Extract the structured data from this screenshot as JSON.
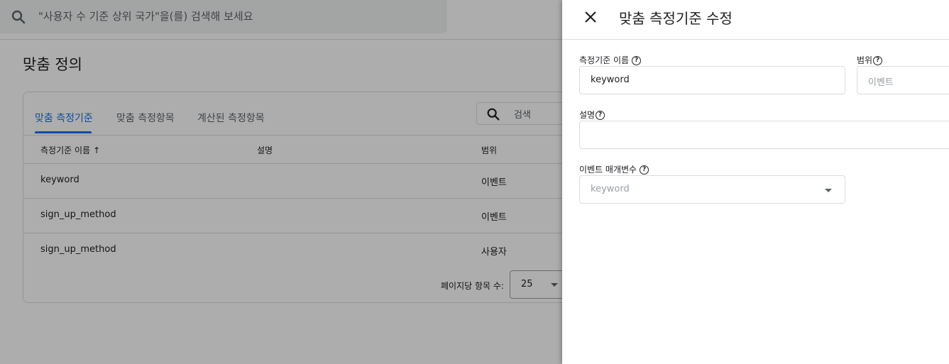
{
  "top_search": {
    "placeholder": "\"사용자 수 기준 상위 국가\"을(를) 검색해 보세요",
    "icon": "search-icon"
  },
  "page": {
    "title": "맞춤 정의"
  },
  "tabs": [
    {
      "label": "맞춤 측정기준",
      "active": true
    },
    {
      "label": "맞춤 측정항목",
      "active": false
    },
    {
      "label": "계산된 측정항목",
      "active": false
    }
  ],
  "table_search": {
    "placeholder": "검색"
  },
  "table": {
    "columns": [
      "측정기준 이름",
      "설명",
      "범위"
    ],
    "sort_arrow": "↑",
    "rows": [
      {
        "name": "keyword",
        "desc": "",
        "scope": "이벤트"
      },
      {
        "name": "sign_up_method",
        "desc": "",
        "scope": "이벤트"
      },
      {
        "name": "sign_up_method",
        "desc": "",
        "scope": "사용자"
      }
    ]
  },
  "pager": {
    "label": "페이지당 항목 수:",
    "value": "25"
  },
  "panel": {
    "title": "맞춤 측정기준 수정",
    "close_icon": "close-icon",
    "name_label": "측정기준 이름",
    "name_value": "keyword",
    "scope_label": "범위",
    "scope_value": "이벤트",
    "desc_label": "설명",
    "desc_value": "",
    "param_label": "이벤트 매개변수",
    "param_value": "keyword"
  },
  "colors": {
    "accent": "#1a73e8",
    "scrim": "rgba(0,0,0,0.32)"
  }
}
